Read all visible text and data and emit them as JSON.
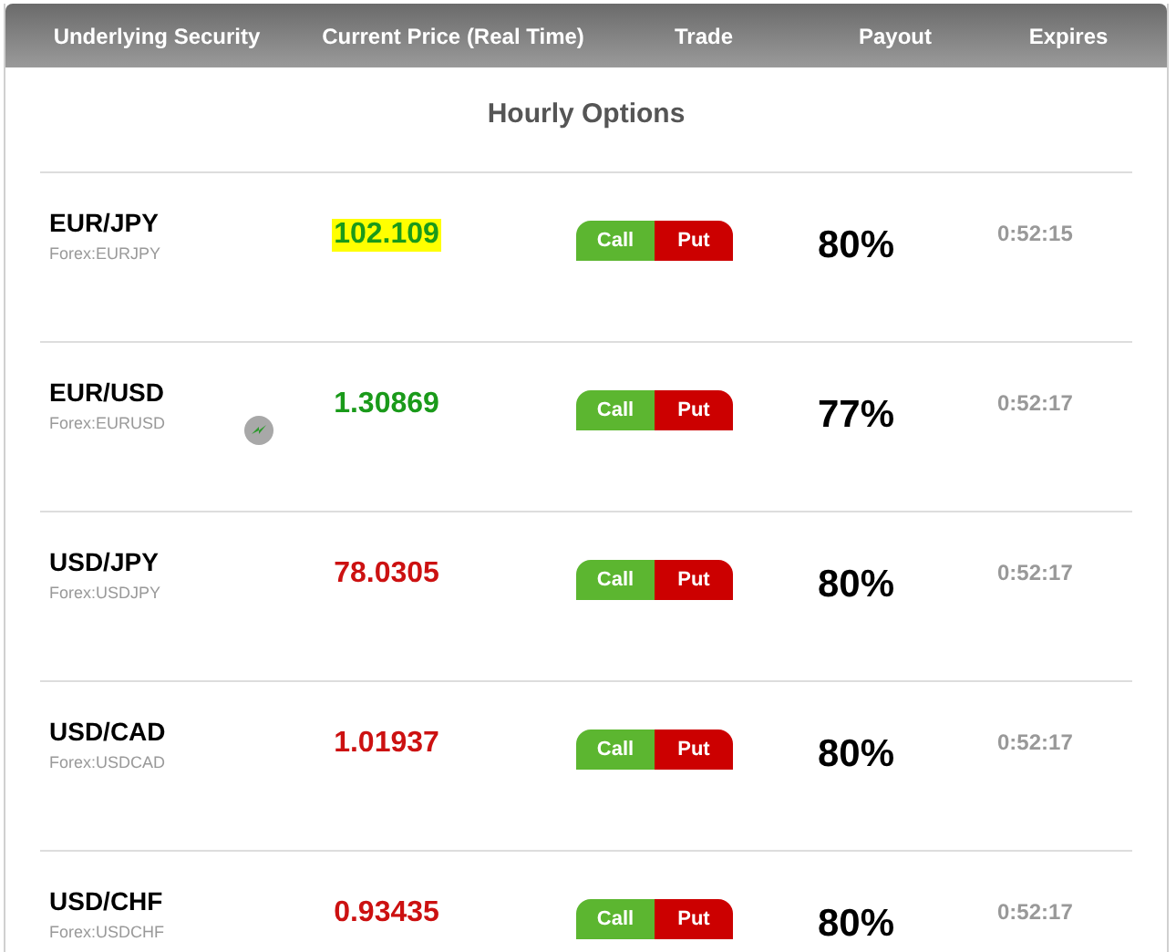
{
  "columns": [
    "Underlying Security",
    "Current Price (Real Time)",
    "Trade",
    "Payout",
    "Expires"
  ],
  "section_title": "Hourly Options",
  "rows": [
    {
      "symbol": "EUR/JPY",
      "market": "Forex:EURJPY",
      "price": "102.109",
      "color": "#1a9a1a",
      "highlighted": true,
      "indicator": false,
      "call": "Call",
      "put": "Put",
      "payout": "80%",
      "expires": "0:52:15"
    },
    {
      "symbol": "EUR/USD",
      "market": "Forex:EURUSD",
      "price": "1.30869",
      "color": "#1a9a1a",
      "highlighted": false,
      "indicator": true,
      "call": "Call",
      "put": "Put",
      "payout": "77%",
      "expires": "0:52:17"
    },
    {
      "symbol": "USD/JPY",
      "market": "Forex:USDJPY",
      "price": "78.0305",
      "color": "#cc1111",
      "highlighted": false,
      "indicator": false,
      "call": "Call",
      "put": "Put",
      "payout": "80%",
      "expires": "0:52:17"
    },
    {
      "symbol": "USD/CAD",
      "market": "Forex:USDCAD",
      "price": "1.01937",
      "color": "#cc1111",
      "highlighted": false,
      "indicator": false,
      "call": "Call",
      "put": "Put",
      "payout": "80%",
      "expires": "0:52:17"
    },
    {
      "symbol": "USD/CHF",
      "market": "Forex:USDCHF",
      "price": "0.93435",
      "color": "#cc1111",
      "highlighted": false,
      "indicator": false,
      "call": "Call",
      "put": "Put",
      "payout": "80%",
      "expires": "0:52:17"
    }
  ]
}
